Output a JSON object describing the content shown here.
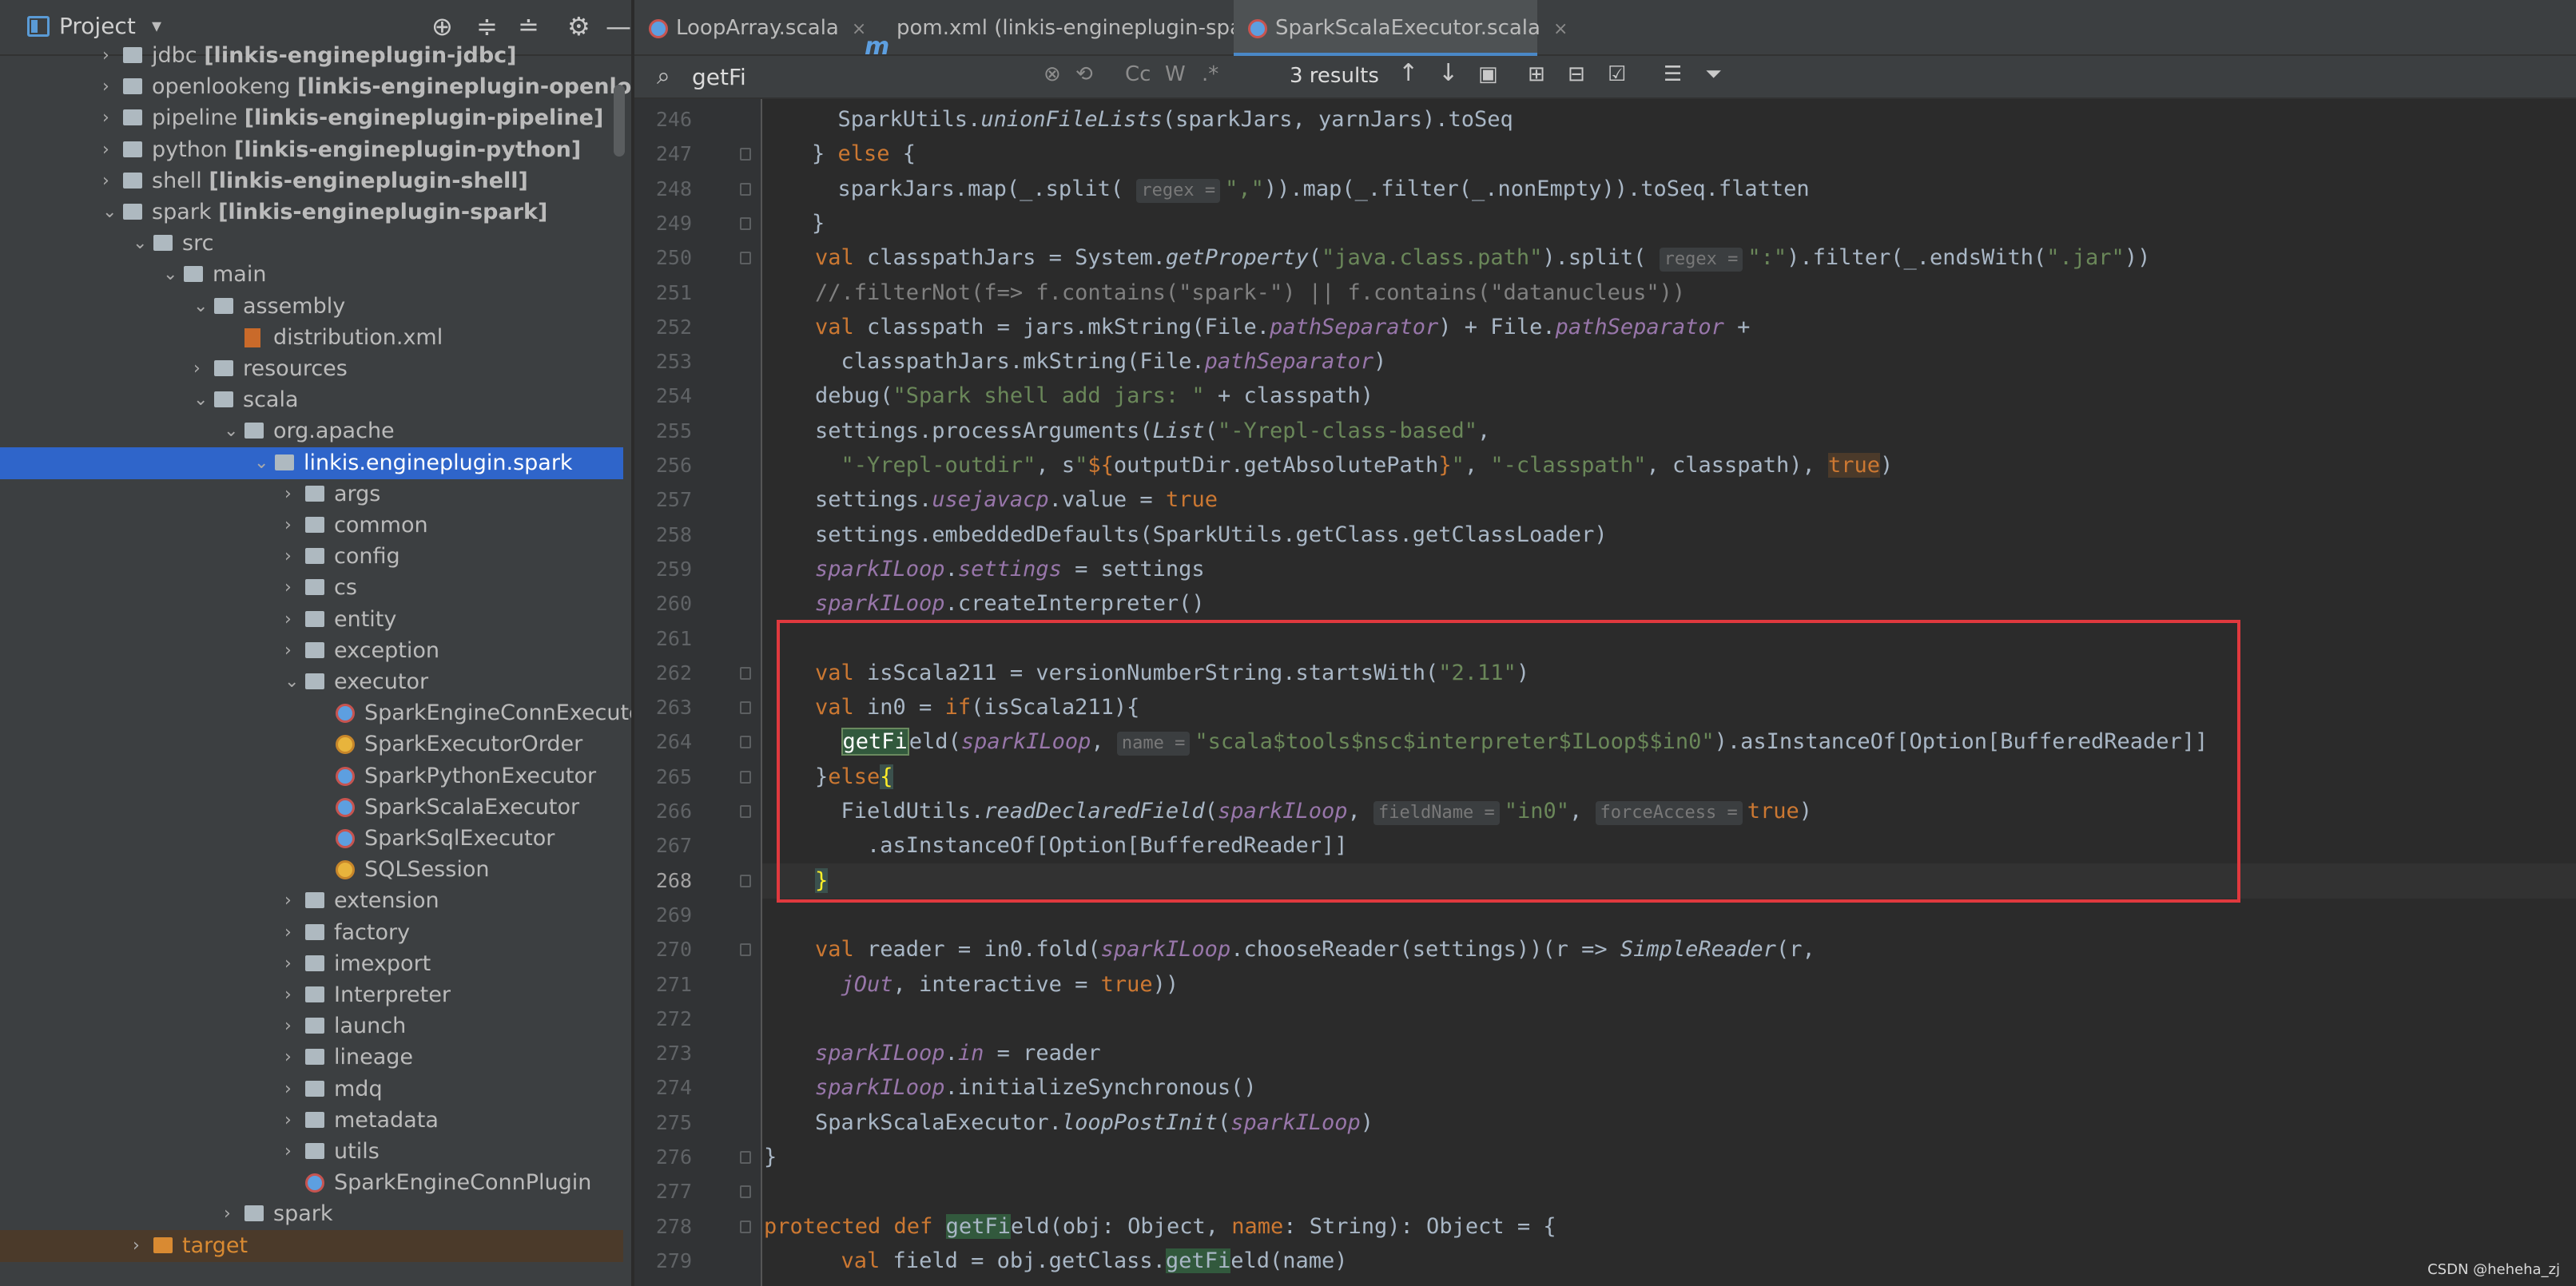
{
  "project_panel": {
    "title": "Project",
    "tree": [
      {
        "indent": 0,
        "arrow": "›",
        "icon": "folder",
        "label": "jdbc ",
        "module": "[linkis-engineplugin-jdbc]"
      },
      {
        "indent": 0,
        "arrow": "›",
        "icon": "folder",
        "label": "openlookeng ",
        "module": "[linkis-engineplugin-openlooke"
      },
      {
        "indent": 0,
        "arrow": "›",
        "icon": "folder",
        "label": "pipeline ",
        "module": "[linkis-engineplugin-pipeline]"
      },
      {
        "indent": 0,
        "arrow": "›",
        "icon": "folder",
        "label": "python ",
        "module": "[linkis-engineplugin-python]"
      },
      {
        "indent": 0,
        "arrow": "›",
        "icon": "folder",
        "label": "shell ",
        "module": "[linkis-engineplugin-shell]"
      },
      {
        "indent": 0,
        "arrow": "⌄",
        "icon": "folder",
        "label": "spark ",
        "module": "[linkis-engineplugin-spark]"
      },
      {
        "indent": 1,
        "arrow": "⌄",
        "icon": "folder",
        "label": "src",
        "module": ""
      },
      {
        "indent": 2,
        "arrow": "⌄",
        "icon": "folder",
        "label": "main",
        "module": ""
      },
      {
        "indent": 3,
        "arrow": "⌄",
        "icon": "folder",
        "label": "assembly",
        "module": ""
      },
      {
        "indent": 4,
        "arrow": "",
        "icon": "xml",
        "label": "distribution.xml",
        "module": ""
      },
      {
        "indent": 3,
        "arrow": "›",
        "icon": "folder",
        "label": "resources",
        "module": ""
      },
      {
        "indent": 3,
        "arrow": "⌄",
        "icon": "folder",
        "label": "scala",
        "module": ""
      },
      {
        "indent": 4,
        "arrow": "⌄",
        "icon": "folder",
        "label": "org.apache",
        "module": ""
      },
      {
        "indent": 5,
        "arrow": "⌄",
        "icon": "folder",
        "label": "linkis.engineplugin.spark",
        "module": "",
        "selected": true
      },
      {
        "indent": 6,
        "arrow": "›",
        "icon": "folder",
        "label": "args",
        "module": ""
      },
      {
        "indent": 6,
        "arrow": "›",
        "icon": "folder",
        "label": "common",
        "module": ""
      },
      {
        "indent": 6,
        "arrow": "›",
        "icon": "folder",
        "label": "config",
        "module": ""
      },
      {
        "indent": 6,
        "arrow": "›",
        "icon": "folder",
        "label": "cs",
        "module": ""
      },
      {
        "indent": 6,
        "arrow": "›",
        "icon": "folder",
        "label": "entity",
        "module": ""
      },
      {
        "indent": 6,
        "arrow": "›",
        "icon": "folder",
        "label": "exception",
        "module": ""
      },
      {
        "indent": 6,
        "arrow": "⌄",
        "icon": "folder",
        "label": "executor",
        "module": ""
      },
      {
        "indent": 7,
        "arrow": "",
        "icon": "scala-c",
        "label": "SparkEngineConnExecutor",
        "module": ""
      },
      {
        "indent": 7,
        "arrow": "",
        "icon": "scala-o",
        "label": "SparkExecutorOrder",
        "module": ""
      },
      {
        "indent": 7,
        "arrow": "",
        "icon": "scala-c",
        "label": "SparkPythonExecutor",
        "module": ""
      },
      {
        "indent": 7,
        "arrow": "",
        "icon": "scala-c",
        "label": "SparkScalaExecutor",
        "module": ""
      },
      {
        "indent": 7,
        "arrow": "",
        "icon": "scala-c",
        "label": "SparkSqlExecutor",
        "module": ""
      },
      {
        "indent": 7,
        "arrow": "",
        "icon": "scala-o",
        "label": "SQLSession",
        "module": ""
      },
      {
        "indent": 6,
        "arrow": "›",
        "icon": "folder",
        "label": "extension",
        "module": ""
      },
      {
        "indent": 6,
        "arrow": "›",
        "icon": "folder",
        "label": "factory",
        "module": ""
      },
      {
        "indent": 6,
        "arrow": "›",
        "icon": "folder",
        "label": "imexport",
        "module": ""
      },
      {
        "indent": 6,
        "arrow": "›",
        "icon": "folder",
        "label": "Interpreter",
        "module": ""
      },
      {
        "indent": 6,
        "arrow": "›",
        "icon": "folder",
        "label": "launch",
        "module": ""
      },
      {
        "indent": 6,
        "arrow": "›",
        "icon": "folder",
        "label": "lineage",
        "module": ""
      },
      {
        "indent": 6,
        "arrow": "›",
        "icon": "folder",
        "label": "mdq",
        "module": ""
      },
      {
        "indent": 6,
        "arrow": "›",
        "icon": "folder",
        "label": "metadata",
        "module": ""
      },
      {
        "indent": 6,
        "arrow": "›",
        "icon": "folder",
        "label": "utils",
        "module": ""
      },
      {
        "indent": 6,
        "arrow": "",
        "icon": "scala-c",
        "label": "SparkEngineConnPlugin",
        "module": ""
      },
      {
        "indent": 4,
        "arrow": "›",
        "icon": "folder",
        "label": "spark",
        "module": ""
      },
      {
        "indent": 1,
        "arrow": "›",
        "icon": "folder-orange",
        "label": "target",
        "module": "",
        "target": true
      }
    ]
  },
  "tabs": [
    {
      "label": "LoopArray.scala",
      "icon": "scala-c",
      "active": false
    },
    {
      "label": "pom.xml (linkis-engineplugin-spark)",
      "icon": "maven",
      "active": false
    },
    {
      "label": "SparkScalaExecutor.scala",
      "icon": "scala-c",
      "active": true
    }
  ],
  "search": {
    "query": "getFi",
    "results": "3 results",
    "option_case": "Cc",
    "option_word": "W",
    "option_regex": ".*"
  },
  "editor": {
    "lines": [
      {
        "n": "246",
        "html": "  SparkUtils.<span class=\"it\">unionFileLists</span>(sparkJars, yarnJars).toSeq"
      },
      {
        "n": "247",
        "html": "} <span class=\"kw\">else</span> {"
      },
      {
        "n": "248",
        "html": "  sparkJars.map(_.split( <span class=\"hint\">regex =</span><span class=\"str\">\",\"</span>)).map(_.filter(_.nonEmpty)).toSeq.flatten"
      },
      {
        "n": "249",
        "html": "}"
      },
      {
        "n": "250",
        "html": "<span class=\"kw\">val</span> classpathJars = System.<span class=\"it\">getProperty</span>(<span class=\"str\">\"java.class.path\"</span>).split( <span class=\"hint\">regex =</span><span class=\"str\">\":\"</span>).filter(_.endsWith(<span class=\"str\">\".jar\"</span>))"
      },
      {
        "n": "251",
        "html": "<span class=\"cmt\">//.filterNot(f=&gt; f.contains(\"spark-\") || f.contains(\"datanucleus\"))</span>"
      },
      {
        "n": "252",
        "html": "<span class=\"kw\">val</span> classpath = jars.mkString(File.<span class=\"purp\">pathSeparator</span>) + File.<span class=\"purp\">pathSeparator</span> +"
      },
      {
        "n": "253",
        "html": "  classpathJars.mkString(File.<span class=\"purp\">pathSeparator</span>)"
      },
      {
        "n": "254",
        "html": "debug(<span class=\"str\">\"Spark shell add jars: \"</span> + classpath)"
      },
      {
        "n": "255",
        "html": "settings.processArguments(<span class=\"it\">List</span>(<span class=\"str\">\"-Yrepl-class-based\"</span>,"
      },
      {
        "n": "256",
        "html": "  <span class=\"str\">\"-Yrepl-outdir\"</span>, s<span class=\"str\">\"</span><span class=\"kw\">${</span>outputDir.getAbsolutePath<span class=\"kw\">}</span><span class=\"str\">\"</span>, <span class=\"str\">\"-classpath\"</span>, classpath), <span class=\"kw tru\">true</span>)"
      },
      {
        "n": "257",
        "html": "settings.<span class=\"purp\">usejavacp</span>.value = <span class=\"kw\">true</span>"
      },
      {
        "n": "258",
        "html": "settings.embeddedDefaults(SparkUtils.getClass.getClassLoader)"
      },
      {
        "n": "259",
        "html": "<span class=\"purp\">sparkILoop</span>.<span class=\"purp\">settings</span> = settings"
      },
      {
        "n": "260",
        "html": "<span class=\"purp\">sparkILoop</span>.createInterpreter()"
      },
      {
        "n": "261",
        "html": ""
      },
      {
        "n": "262",
        "html": "<span class=\"kw\">val</span> isScala211 = versionNumberString.startsWith(<span class=\"str\">\"2.11\"</span>)"
      },
      {
        "n": "263",
        "html": "<span class=\"kw\">val</span> in0 = <span class=\"kw\">if</span>(isScala211){"
      },
      {
        "n": "264",
        "html": "  <span class=\"match\">getFi</span>eld(<span class=\"purp\">sparkILoop</span>, <span class=\"hint\">name =</span><span class=\"str\">\"scala$tools$nsc$interpreter$ILoop$$in0\"</span>).asInstanceOf[Option[BufferedReader]]"
      },
      {
        "n": "265",
        "html": "}<span class=\"kw\">else</span><span class=\"brace\">{</span>"
      },
      {
        "n": "266",
        "html": "  FieldUtils.<span class=\"it\">readDeclaredField</span>(<span class=\"purp\">sparkILoop</span>, <span class=\"hint\">fieldName =</span><span class=\"str\">\"in0\"</span>, <span class=\"hint\">forceAccess =</span><span class=\"kw\">true</span>)"
      },
      {
        "n": "267",
        "html": "    .asInstanceOf[Option[BufferedReader]]"
      },
      {
        "n": "268",
        "html": "<span class=\"brace\">}</span>"
      },
      {
        "n": "269",
        "html": ""
      },
      {
        "n": "270",
        "html": "<span class=\"kw\">val</span> reader = in0.fold(<span class=\"purp\">sparkILoop</span>.chooseReader(settings))(r =&gt; <span class=\"it\">SimpleReader</span>(r,"
      },
      {
        "n": "271",
        "html": "  <span class=\"purp\">jOut</span>, interactive = <span class=\"kw\">true</span>))"
      },
      {
        "n": "272",
        "html": ""
      },
      {
        "n": "273",
        "html": "<span class=\"purp\">sparkILoop</span>.<span class=\"purp\">in</span> = reader"
      },
      {
        "n": "274",
        "html": "<span class=\"purp\">sparkILoop</span>.initializeSynchronous()"
      },
      {
        "n": "275",
        "html": "SparkScalaExecutor.<span class=\"it\">loopPostInit</span>(<span class=\"purp\">sparkILoop</span>)"
      },
      {
        "n": "276",
        "html": "}"
      },
      {
        "n": "277",
        "html": ""
      },
      {
        "n": "278",
        "html": "<span class=\"kw\">protected def</span> <span class=\"match2\">getFi</span>eld(obj: Object, <span class=\"kw\">name</span>: String): Object = {"
      },
      {
        "n": "279",
        "html": "  <span class=\"kw\">val</span> field = obj.getClass.<span class=\"match2\">getFi</span>eld(name)"
      }
    ]
  },
  "watermark": "CSDN @heheha_zj"
}
